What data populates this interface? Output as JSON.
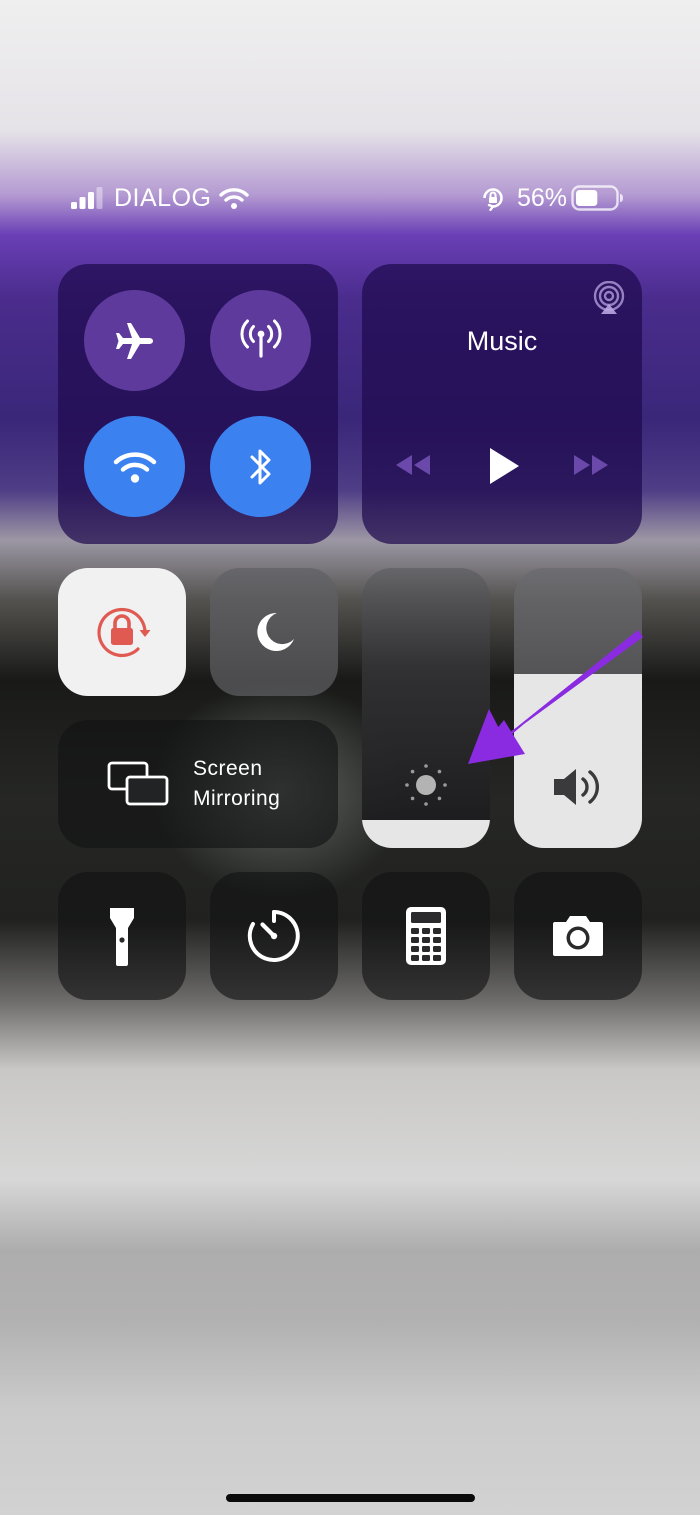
{
  "status_bar": {
    "carrier": "DIALOG",
    "battery_percent_label": "56%",
    "signal_bars_filled": 3,
    "signal_bars_total": 4,
    "battery_level": 0.56
  },
  "connectivity": {
    "airplane_mode": false,
    "cellular_data": false,
    "wifi": true,
    "bluetooth": true
  },
  "music": {
    "title": "Music"
  },
  "screen_mirroring": {
    "label_line1": "Screen",
    "label_line2": "Mirroring"
  },
  "sliders": {
    "brightness_level": 0.1,
    "volume_level": 0.62
  },
  "icons": {
    "airplane": "airplane-icon",
    "cellular": "cellular-antenna-icon",
    "wifi": "wifi-icon",
    "bluetooth": "bluetooth-icon",
    "airplay": "airplay-icon",
    "rewind": "rewind-icon",
    "play": "play-icon",
    "fast_forward": "fast-forward-icon",
    "orientation_lock": "orientation-lock-icon",
    "do_not_disturb": "moon-icon",
    "screen_mirroring": "screen-mirroring-icon",
    "brightness": "sun-icon",
    "volume": "speaker-icon",
    "flashlight": "flashlight-icon",
    "timer": "timer-icon",
    "calculator": "calculator-icon",
    "camera": "camera-icon"
  },
  "colors": {
    "toggle_on": "#3b82f0",
    "toggle_off": "#623ea2",
    "orientation_lock_active": "#e05a52",
    "annotation_arrow": "#8a2be2"
  }
}
